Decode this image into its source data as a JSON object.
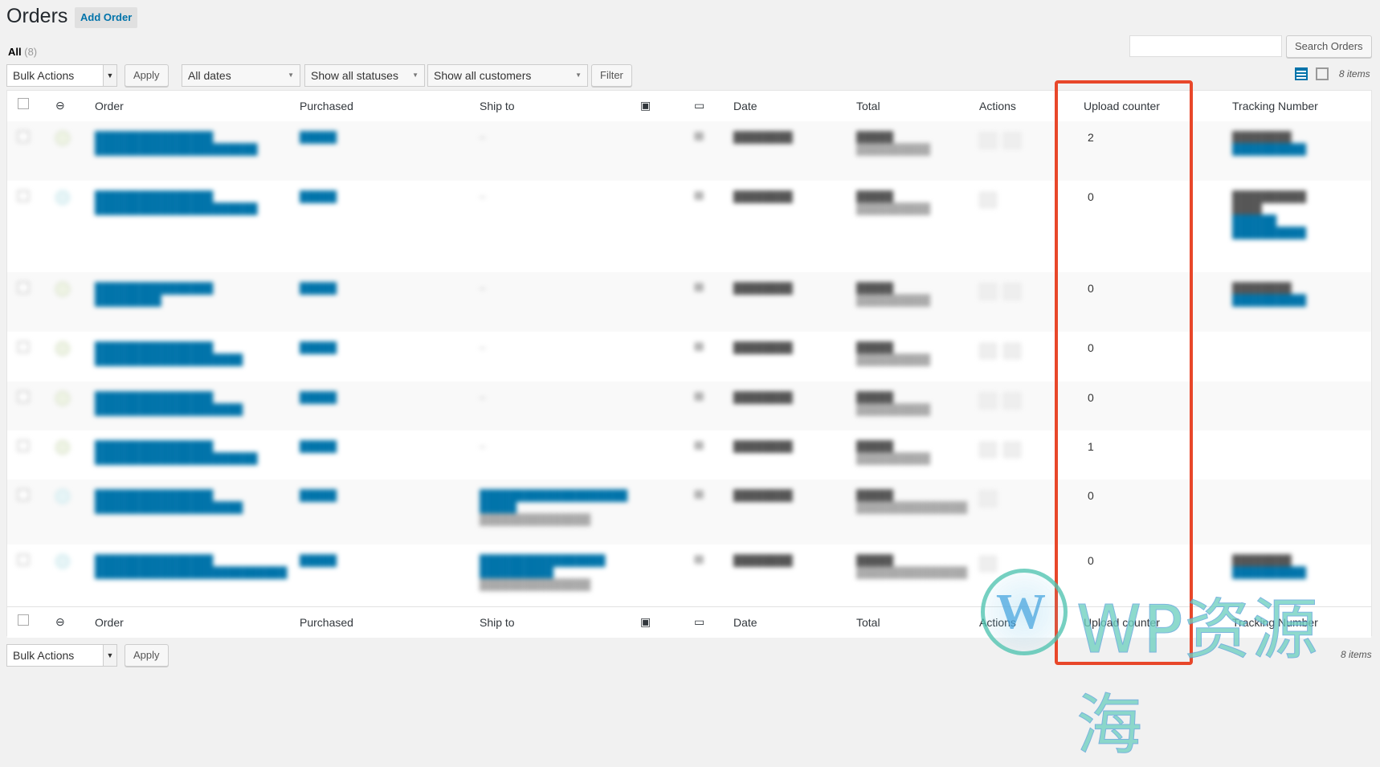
{
  "page": {
    "title": "Orders",
    "add_button": "Add Order"
  },
  "subsubsub": {
    "all_label": "All",
    "all_count": "(8)"
  },
  "search": {
    "button": "Search Orders",
    "value": ""
  },
  "toolbar": {
    "bulk_actions": "Bulk Actions",
    "apply": "Apply",
    "dates": "All dates",
    "statuses": "Show all statuses",
    "customers": "Show all customers",
    "filter": "Filter",
    "items": "8 items"
  },
  "columns": {
    "order": "Order",
    "purchased": "Purchased",
    "ship_to": "Ship to",
    "date": "Date",
    "total": "Total",
    "actions": "Actions",
    "upload_counter": "Upload counter",
    "tracking_number": "Tracking Number"
  },
  "rows": [
    {
      "upload_counter": "2"
    },
    {
      "upload_counter": "0"
    },
    {
      "upload_counter": "0"
    },
    {
      "upload_counter": "0"
    },
    {
      "upload_counter": "0"
    },
    {
      "upload_counter": "1"
    },
    {
      "upload_counter": "0"
    },
    {
      "upload_counter": "0"
    }
  ],
  "watermark": {
    "text": "WP资源海",
    "logo_letter": "W"
  },
  "colors": {
    "highlight": "#e8472a",
    "link": "#0073aa",
    "watermark": "#6fd0c0"
  }
}
